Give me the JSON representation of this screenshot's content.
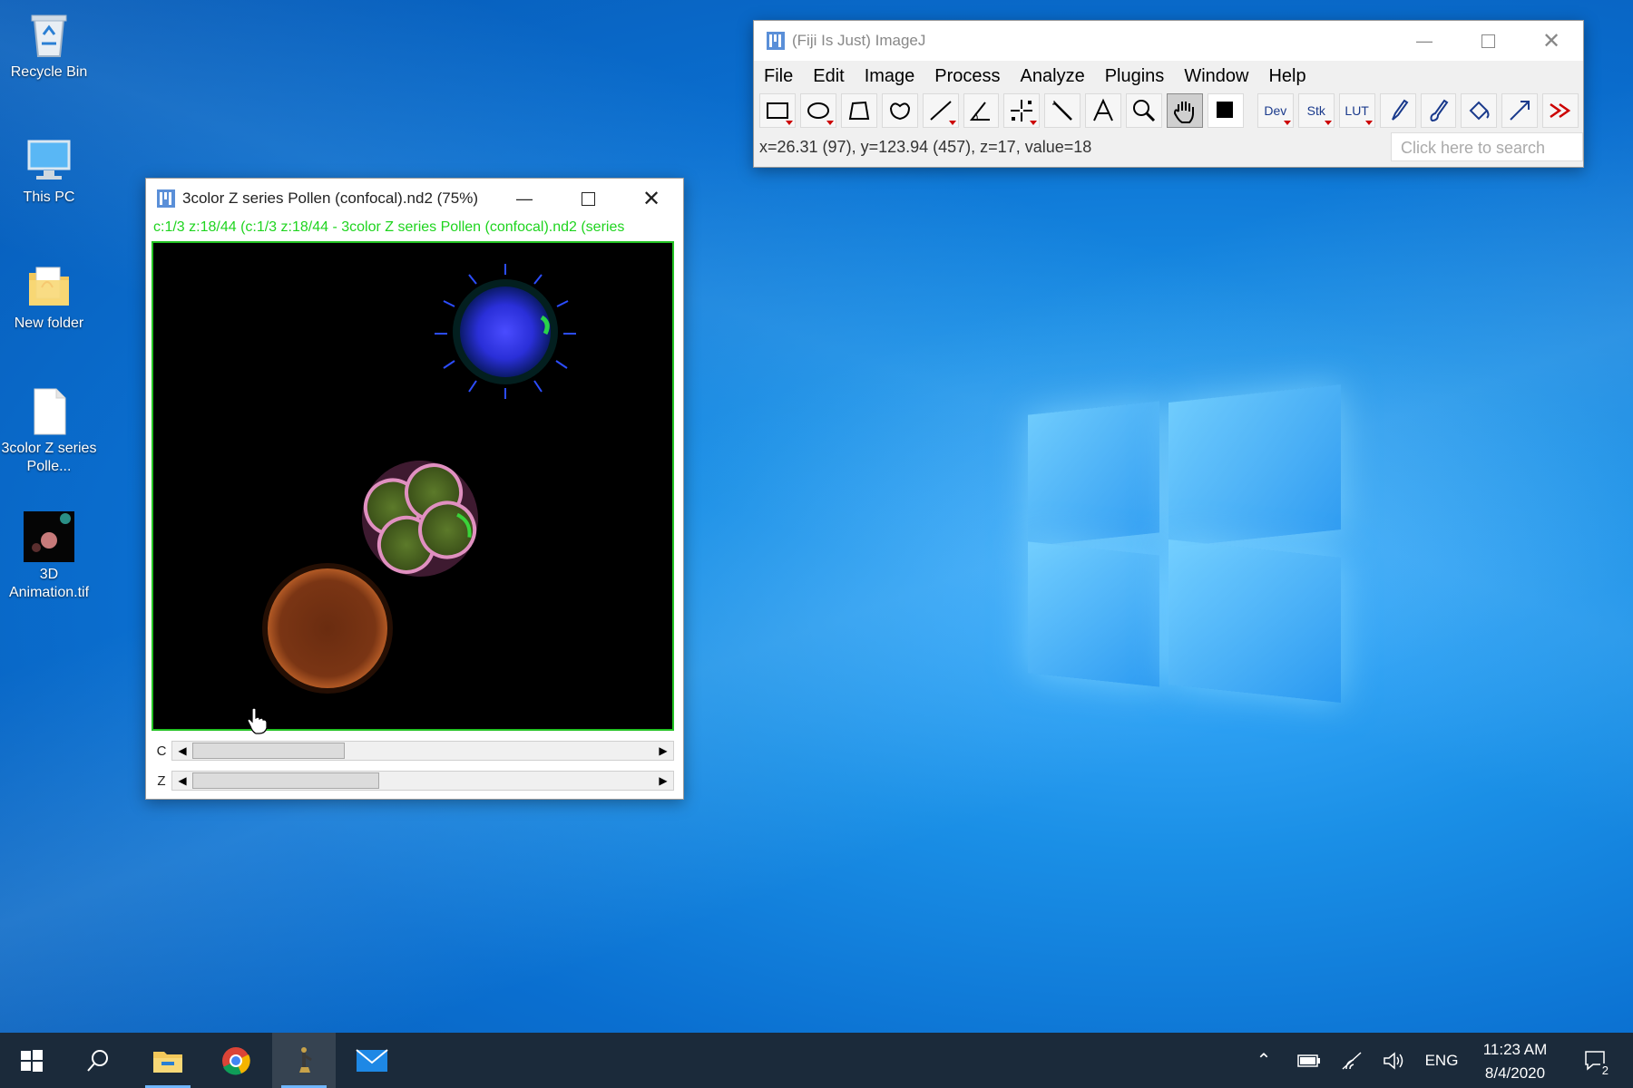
{
  "desktop": {
    "icons": [
      {
        "label": "Recycle Bin",
        "icon": "recycle-bin-icon"
      },
      {
        "label": "This PC",
        "icon": "computer-icon"
      },
      {
        "label": "New folder",
        "icon": "folder-icon"
      },
      {
        "label": "3color Z series Polle...",
        "icon": "file-icon"
      },
      {
        "label": "3D Animation.tif",
        "icon": "image-thumbnail-icon"
      }
    ]
  },
  "fiji": {
    "title": "(Fiji Is Just) ImageJ",
    "menu": [
      "File",
      "Edit",
      "Image",
      "Process",
      "Analyze",
      "Plugins",
      "Window",
      "Help"
    ],
    "tools": [
      {
        "name": "rectangle-tool",
        "icon": "rectangle-icon"
      },
      {
        "name": "oval-tool",
        "icon": "oval-icon"
      },
      {
        "name": "polygon-tool",
        "icon": "polygon-icon"
      },
      {
        "name": "freehand-tool",
        "icon": "freehand-icon"
      },
      {
        "name": "line-tool",
        "icon": "line-icon"
      },
      {
        "name": "angle-tool",
        "icon": "angle-icon"
      },
      {
        "name": "point-tool",
        "icon": "point-icon"
      },
      {
        "name": "wand-tool",
        "icon": "wand-icon"
      },
      {
        "name": "text-tool",
        "icon": "text-icon"
      },
      {
        "name": "magnifier-tool",
        "icon": "magnifier-icon"
      },
      {
        "name": "hand-tool",
        "icon": "hand-icon",
        "active": true
      },
      {
        "name": "color-picker-tool",
        "icon": "color-picker-icon"
      },
      {
        "name": "dev-tool",
        "label": "Dev"
      },
      {
        "name": "stk-tool",
        "label": "Stk"
      },
      {
        "name": "lut-tool",
        "label": "LUT"
      },
      {
        "name": "pencil-tool",
        "icon": "pencil-icon"
      },
      {
        "name": "brush-tool",
        "icon": "brush-icon"
      },
      {
        "name": "flood-fill-tool",
        "icon": "bucket-icon"
      },
      {
        "name": "arrow-tool",
        "icon": "arrow-icon"
      },
      {
        "name": "more-tools",
        "icon": "double-chevron-icon"
      }
    ],
    "status": "x=26.31 (97), y=123.94 (457), z=17, value=18",
    "search_placeholder": "Click here to search"
  },
  "image_window": {
    "title": "3color Z series Pollen (confocal).nd2 (75%)",
    "subtitle": "c:1/3 z:18/44 (c:1/3 z:18/44 - 3color Z series Pollen (confocal).nd2 (series",
    "sliders": [
      {
        "label": "C",
        "position": 0.333
      },
      {
        "label": "Z",
        "position": 0.409
      }
    ]
  },
  "taskbar": {
    "apps": [
      "start-icon",
      "search-icon",
      "file-explorer-icon",
      "chrome-icon",
      "fiji-icon",
      "mail-icon"
    ],
    "language": "ENG",
    "time": "11:23 AM",
    "date": "8/4/2020",
    "notification_count": "2"
  }
}
